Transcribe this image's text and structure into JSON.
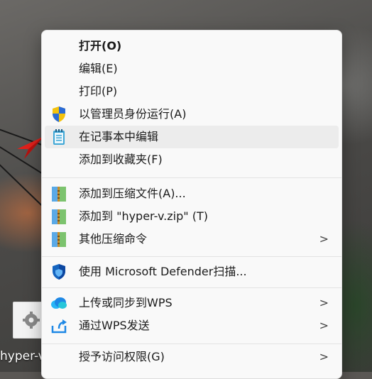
{
  "desktop": {
    "icon_label": "hyper-v"
  },
  "menu": {
    "items": [
      {
        "label": "打开(O)",
        "bold": true
      },
      {
        "label": "编辑(E)"
      },
      {
        "label": "打印(P)"
      },
      {
        "label": "以管理员身份运行(A)",
        "icon": "shield-icon"
      },
      {
        "label": "在记事本中编辑",
        "icon": "notepad-icon"
      },
      {
        "label": "添加到收藏夹(F)"
      },
      {
        "label": "添加到压缩文件(A)...",
        "icon": "winrar-icon"
      },
      {
        "label": "添加到 \"hyper-v.zip\" (T)",
        "icon": "winrar-icon"
      },
      {
        "label": "其他压缩命令",
        "icon": "winrar-icon",
        "submenu": true,
        "chevron": ">"
      },
      {
        "label": "使用 Microsoft Defender扫描...",
        "icon": "defender-icon"
      },
      {
        "label": "上传或同步到WPS",
        "icon": "cloud-icon",
        "submenu": true,
        "chevron": ">"
      },
      {
        "label": "通过WPS发送",
        "icon": "share-icon",
        "submenu": true,
        "chevron": ">"
      },
      {
        "label": "授予访问权限(G)",
        "submenu": true,
        "chevron": ">"
      }
    ]
  },
  "colors": {
    "menu_bg": "#f9f9f9",
    "hover_bg": "#ececec",
    "separator": "#e3e3e3",
    "text": "#1b1b1b",
    "arrow_red": "#e0201b"
  }
}
